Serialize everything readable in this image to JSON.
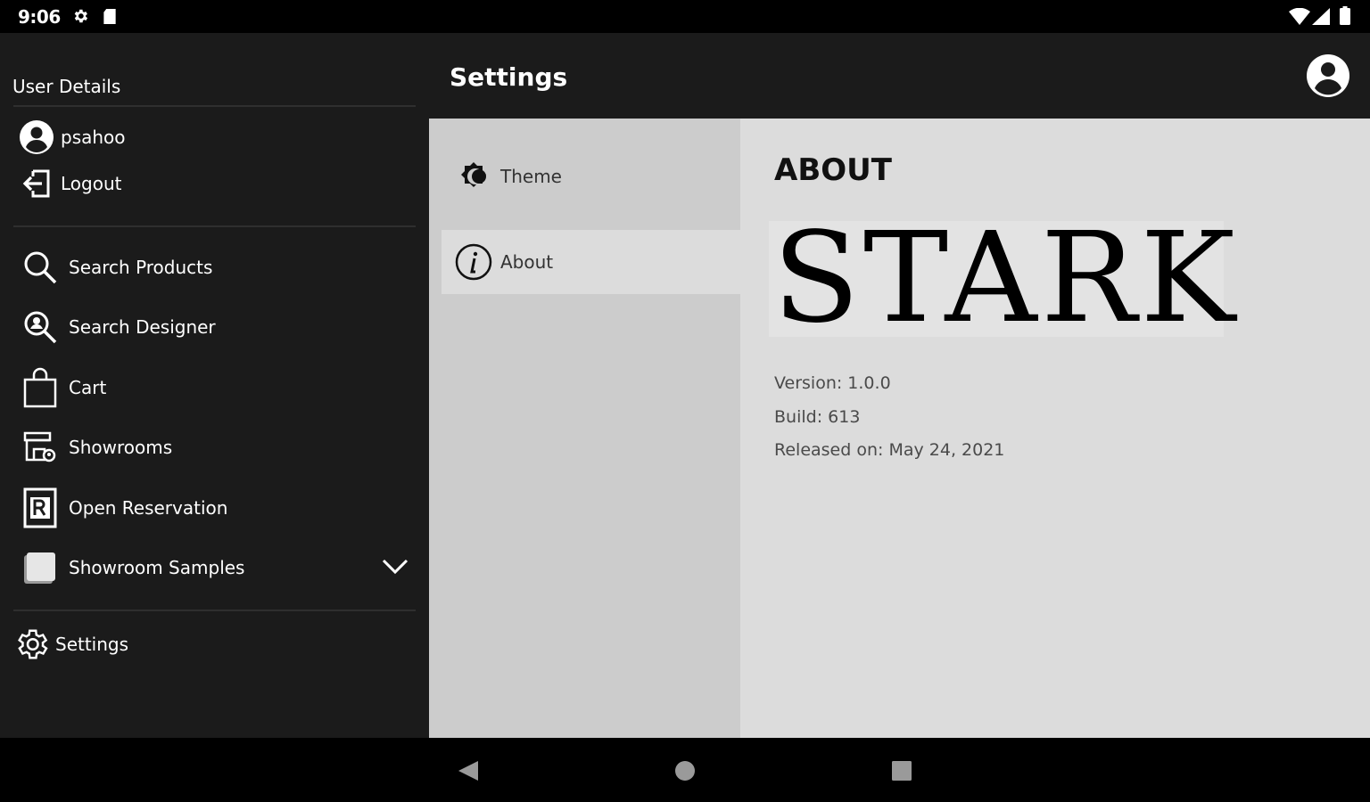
{
  "status_bar": {
    "time": "9:06"
  },
  "drawer": {
    "header": "User Details",
    "user": {
      "name": "psahoo",
      "logout_label": "Logout"
    },
    "items": [
      {
        "label": "Search Products",
        "icon": "search-icon"
      },
      {
        "label": "Search Designer",
        "icon": "search-designer-icon"
      },
      {
        "label": "Cart",
        "icon": "shopping-bag-icon"
      },
      {
        "label": "Showrooms",
        "icon": "showroom-icon"
      },
      {
        "label": "Open Reservation",
        "icon": "reservation-icon"
      },
      {
        "label": "Showroom Samples",
        "icon": "samples-icon"
      }
    ],
    "settings_label": "Settings"
  },
  "appbar": {
    "title": "Settings"
  },
  "settings_list": {
    "items": [
      {
        "label": "Theme",
        "icon": "theme-icon"
      },
      {
        "label": "About",
        "icon": "info-icon",
        "selected": true
      }
    ]
  },
  "about": {
    "title": "ABOUT",
    "logo_text": "STARK",
    "version": "Version: 1.0.0",
    "build": "Build: 613",
    "released": "Released on: May 24, 2021"
  },
  "colors": {
    "drawer_bg": "#1b1b1b",
    "list_bg": "#cccccc",
    "detail_bg": "#dcdcdc",
    "system_bar": "#000000"
  }
}
